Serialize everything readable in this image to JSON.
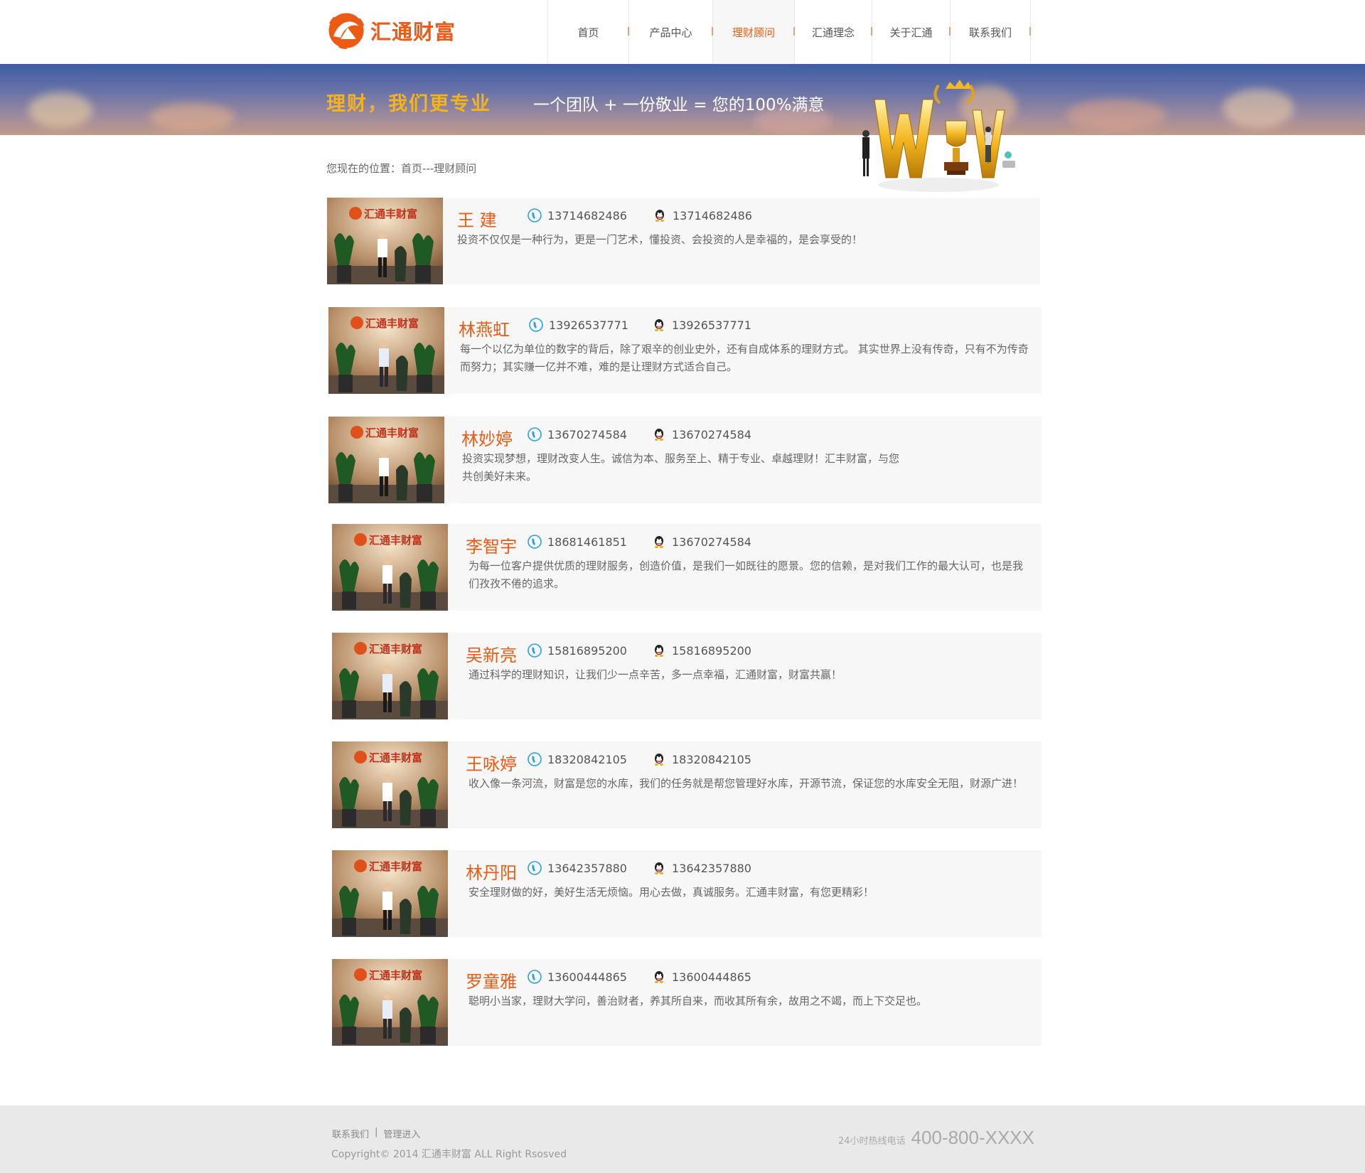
{
  "header": {
    "logo_text": "汇通财富",
    "nav": [
      {
        "label": "首页",
        "active": false
      },
      {
        "label": "产品中心",
        "active": false
      },
      {
        "label": "理财顾问",
        "active": true
      },
      {
        "label": "汇通理念",
        "active": false
      },
      {
        "label": "关于汇通",
        "active": false
      },
      {
        "label": "联系我们",
        "active": false
      }
    ]
  },
  "banner": {
    "slogan": "理财，我们更专业",
    "subtitle": "一个团队 + 一份敬业 = 您的100%满意"
  },
  "breadcrumb": "您现在的位置：首页---理财顾问",
  "advisors": [
    {
      "name": "王 建",
      "phone": "13714682486",
      "qq": "13714682486",
      "desc": "投资不仅仅是一种行为，更是一门艺术，懂投资、会投资的人是幸福的，是会享受的！"
    },
    {
      "name": "林燕虹",
      "phone": "13926537771",
      "qq": "13926537771",
      "desc": "每一个以亿为单位的数字的背后，除了艰辛的创业史外，还有自成体系的理财方式。 其实世界上没有传奇，只有不为传奇而努力；其实赚一亿并不难，难的是让理财方式适合自己。"
    },
    {
      "name": "林妙婷",
      "phone": "13670274584",
      "qq": "13670274584",
      "desc": "投资实现梦想，理财改变人生。诚信为本、服务至上、精于专业、卓越理财！汇丰财富，与您共创美好未来。"
    },
    {
      "name": "李智宇",
      "phone": "18681461851",
      "qq": "13670274584",
      "desc": "为每一位客户提供优质的理财服务，创造价值，是我们一如既往的愿景。您的信赖，是对我们工作的最大认可，也是我们孜孜不倦的追求。"
    },
    {
      "name": "吴新亮",
      "phone": "15816895200",
      "qq": "15816895200",
      "desc": "通过科学的理财知识，让我们少一点辛苦，多一点幸福，汇通财富，财富共赢！"
    },
    {
      "name": "王咏婷",
      "phone": "18320842105",
      "qq": "18320842105",
      "desc": "收入像一条河流，财富是您的水库，我们的任务就是帮您管理好水库，开源节流，保证您的水库安全无阻，财源广进！"
    },
    {
      "name": "林丹阳",
      "phone": "13642357880",
      "qq": "13642357880",
      "desc": "安全理财做的好，美好生活无烦恼。用心去做，真诚服务。汇通丰财富，有您更精彩！"
    },
    {
      "name": "罗童雅",
      "phone": "13600444865",
      "qq": "13600444865",
      "desc": "聪明小当家，理财大学问，善治财者，养其所自来，而收其所有余，故用之不竭，而上下交足也。"
    }
  ],
  "photo_sign": "汇通丰财富",
  "footer": {
    "links": [
      "联系我们",
      "|",
      "管理进入"
    ],
    "copyright": "Copyright© 2014 汇通丰财富 ALL Right Rsosved",
    "hotline_label": "24小时热线电话",
    "hotline_number": "400-800-XXXX"
  },
  "colors": {
    "accent": "#ec5a14",
    "gold": "#f7b31c",
    "card_bg": "#f7f7f7",
    "footer_bg": "#e9e9e9"
  }
}
